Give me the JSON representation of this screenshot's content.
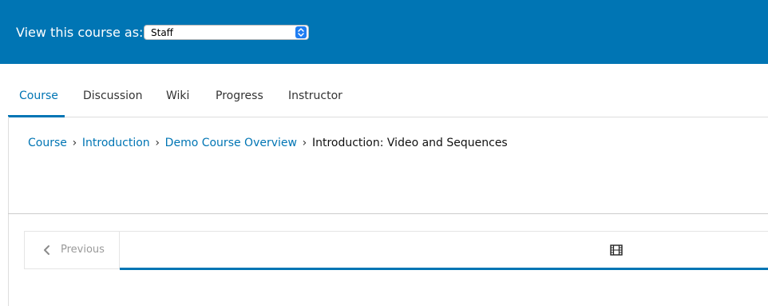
{
  "staff_bar": {
    "label": "View this course as:",
    "select_value": "Staff"
  },
  "tabs": [
    {
      "label": "Course",
      "active": true
    },
    {
      "label": "Discussion"
    },
    {
      "label": "Wiki"
    },
    {
      "label": "Progress"
    },
    {
      "label": "Instructor"
    }
  ],
  "breadcrumb": {
    "items": [
      "Course",
      "Introduction",
      "Demo Course Overview"
    ],
    "current": "Introduction: Video and Sequences",
    "separator": "›"
  },
  "sequence_nav": {
    "previous_label": "Previous",
    "unit_icon": "film-icon"
  },
  "colors": {
    "accent": "#0075b4"
  }
}
